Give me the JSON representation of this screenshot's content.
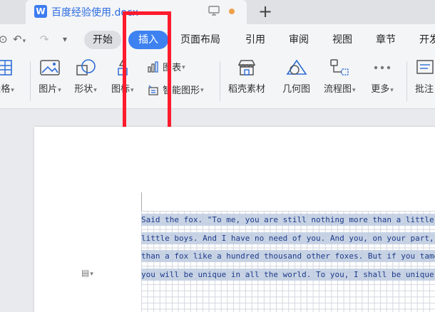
{
  "titlebar": {
    "doc_icon_letter": "W",
    "doc_title": "百度经验使用.docx",
    "new_tab_label": "+"
  },
  "menubar": {
    "items": [
      "开始",
      "插入",
      "页面布局",
      "引用",
      "审阅",
      "视图",
      "章节",
      "开发"
    ],
    "active": "插入"
  },
  "ribbon": {
    "table": "表格",
    "picture": "图片",
    "shape": "形状",
    "icon": "图标",
    "chart": "图表",
    "smart_graphic": "智能图形",
    "daoke": "稻壳素材",
    "geometry": "几何图",
    "flowchart": "流程图",
    "more": "更多",
    "comment": "批注"
  },
  "document": {
    "lines": [
      "Said the fox. \"To me, you are still nothing more than a little boy who is just like a hundred thousand other",
      "little boys. And I have no need of you. And you, on your part, have no need of me. To you, I am nothing more",
      "than a fox like a hundred thousand other foxes. But if you tame me, then we shall need each other. To me,",
      "you will be unique in all the world. To you, I shall be unique in all the world..."
    ]
  },
  "colors": {
    "accent": "#3d82f0",
    "highlight": "#ff1b2d",
    "text": "#1e3a8a"
  }
}
